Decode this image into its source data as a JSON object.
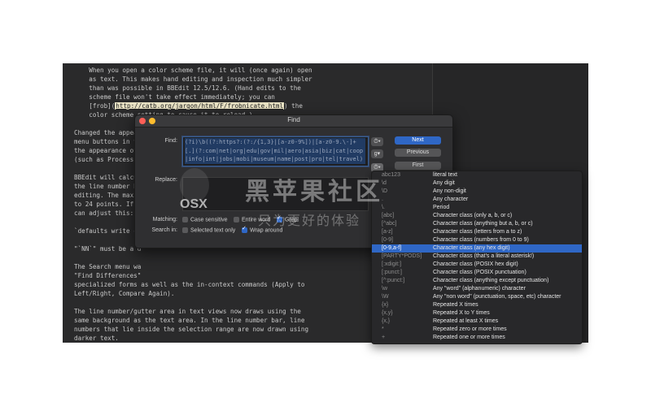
{
  "editor": {
    "lines": [
      {
        "text": "    When you open a color scheme file, it will (once again) open"
      },
      {
        "text": "    as text. This makes hand editing and inspection much simpler"
      },
      {
        "text": "    than was possible in BBEdit 12.5/12.6. (Hand edits to the"
      },
      {
        "text": "    scheme file won't take effect immediately; you can"
      },
      {
        "text": "    [frob](http://catb.org/jargon/html/F/frobnicate.html) the",
        "has_link": true
      },
      {
        "text": "    color scheme setting to cause it to reload.)"
      },
      {
        "text": ""
      },
      {
        "text": "Changed the appear"
      },
      {
        "text": "menu buttons in th"
      },
      {
        "text": "the appearance of"
      },
      {
        "text": "(such as Process L"
      },
      {
        "text": ""
      },
      {
        "text": "BBEdit will calcul"
      },
      {
        "text": "the line number ba"
      },
      {
        "text": "editing. The maxim"
      },
      {
        "text": "to 24 points. If y"
      },
      {
        "text": "can adjust this:"
      },
      {
        "text": ""
      },
      {
        "text": "`defaults write co"
      },
      {
        "text": ""
      },
      {
        "text": "\"`NN`\" must be a d"
      },
      {
        "text": ""
      },
      {
        "text": "The Search menu wa"
      },
      {
        "text": "\"Find Differences\""
      },
      {
        "text": "specialized forms as well as the in-context commands (Apply to"
      },
      {
        "text": "Left/Right, Compare Again)."
      },
      {
        "text": ""
      },
      {
        "text": "The line number/gutter area in text views now draws using the"
      },
      {
        "text": "same background as the text area. In the line number bar, line"
      },
      {
        "text": "numbers that lie inside the selection range are now drawn using"
      },
      {
        "text": "darker text."
      },
      {
        "text": ""
      },
      {
        "text": "Made a change to ask the OS-provided print panel to place the"
      },
      {
        "text": "page attribute controls (orientation, scaling, paper size) in the"
      },
      {
        "text": "panel proper, rather than hiding them behind the \"Page"
      },
      {
        "text": "Attributes\" section in the popup menu."
      }
    ],
    "link": {
      "prefix": "    [frob](",
      "url": "http://catb.org/jargon/html/F/frobnicate.html",
      "suffix": ") the"
    }
  },
  "find_dialog": {
    "title": "Find",
    "find_label": "Find:",
    "find_value": "(?i)\\b((?:https?:(?:/{1,3}|[a-z0-9%])|[a-z0-9.\\-]+[.](?:com|net|org|edu|gov|mil|aero|asia|biz|cat|coop|info|int|jobs|mobi|museum|name|post|pro|tel|travel)",
    "replace_label": "Replace:",
    "replace_value": "",
    "buttons": {
      "next": "Next",
      "previous": "Previous",
      "first": "First"
    },
    "popups": {
      "find_history": "⏱▾",
      "grep_pattern": "g▾",
      "replace_history": "⏱▾"
    },
    "matching_label": "Matching:",
    "matching_options": [
      {
        "label": "Case sensitive",
        "checked": false
      },
      {
        "label": "Entire word",
        "checked": false
      },
      {
        "label": "Grep",
        "checked": true
      }
    ],
    "search_in_label": "Search in:",
    "search_in_options": [
      {
        "label": "Selected text only",
        "checked": false
      },
      {
        "label": "Wrap around",
        "checked": true
      }
    ]
  },
  "grep_menu": {
    "selected_index": 10,
    "items": [
      {
        "token": "abc123",
        "desc": "literal text"
      },
      {
        "token": "\\d",
        "desc": "Any digit"
      },
      {
        "token": "\\D",
        "desc": "Any non-digit"
      },
      {
        "token": ".",
        "desc": "Any character"
      },
      {
        "token": "\\.",
        "desc": "Period"
      },
      {
        "token": "[abc]",
        "desc": "Character class (only a, b, or c)"
      },
      {
        "token": "[^abc]",
        "desc": "Character class (anything but a, b, or c)"
      },
      {
        "token": "[a-z]",
        "desc": "Character class (letters from a to z)"
      },
      {
        "token": "[0-9]",
        "desc": "Character class (numbers from 0 to 9)"
      },
      {
        "token": "[0-9,a-f]",
        "desc": "Character class (any hex digit)"
      },
      {
        "token": "[PARTY*PODS]",
        "desc": "Character class (that's a literal asterisk!)"
      },
      {
        "token": "[:xdigit:]",
        "desc": "Character class (POSIX hex digit)"
      },
      {
        "token": "[:punct:]",
        "desc": "Character class (POSIX punctuation)"
      },
      {
        "token": "[^:punct:]",
        "desc": "Character class (anything except punctuation)"
      },
      {
        "token": "\\w",
        "desc": "Any \"word\" (alphanumeric) character"
      },
      {
        "token": "\\W",
        "desc": "Any \"non word\" (punctuation, space, etc) character"
      },
      {
        "token": "{x}",
        "desc": "Repeated X times"
      },
      {
        "token": "{x,y}",
        "desc": "Repeated X to Y times"
      },
      {
        "token": "{x,}",
        "desc": "Repeated at least X times"
      },
      {
        "token": "*",
        "desc": "Repeated zero or more times"
      },
      {
        "token": "+",
        "desc": "Repeated one or more times"
      }
    ]
  },
  "watermark": {
    "brand": "OSX",
    "cn_title": "黑苹果社区",
    "cn_sub": "只为更好的体验"
  },
  "colors": {
    "accent": "#2f67c6",
    "editor_bg": "#2a2a2b",
    "dialog_bg": "#2f2f31"
  }
}
